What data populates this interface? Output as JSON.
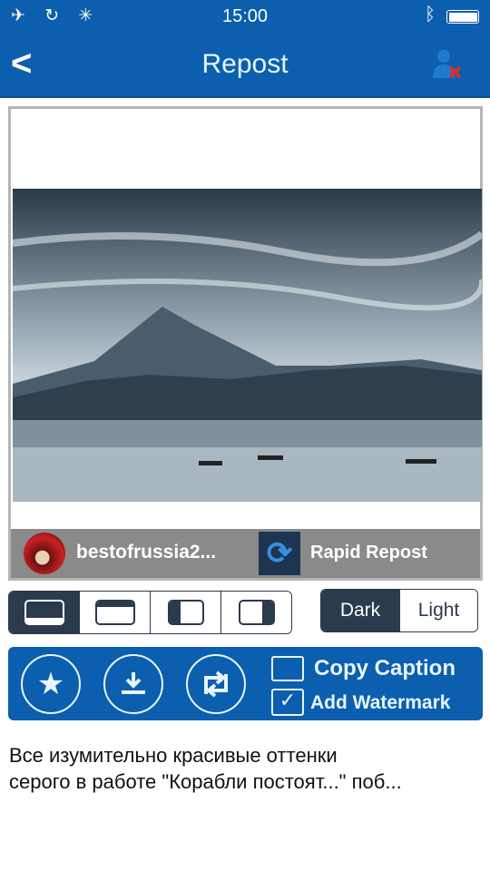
{
  "status_bar": {
    "time": "15:00",
    "left_icons": [
      "airplane-icon",
      "link-icon",
      "activity-spinner-icon"
    ],
    "right_icons": [
      "bluetooth-icon",
      "battery-icon"
    ],
    "battery_level": 1.0
  },
  "nav": {
    "title": "Repost",
    "back_icon": "chevron-left-icon",
    "right_icon": "remove-user-icon"
  },
  "preview": {
    "username": "bestofrussia2...",
    "brand": "Rapid Repost"
  },
  "position_options": {
    "icons": [
      "bottom-bar-icon",
      "top-bar-icon",
      "left-bar-icon",
      "right-bar-icon"
    ],
    "selected": 0
  },
  "theme": {
    "options": [
      "Dark",
      "Light"
    ],
    "selected": "Dark"
  },
  "actions": {
    "icons": [
      "star-icon",
      "download-icon",
      "repost-icon"
    ],
    "copy_caption": {
      "label": "Copy Caption",
      "checked": false
    },
    "add_watermark": {
      "label": "Add Watermark",
      "checked": true
    }
  },
  "caption": {
    "lines": [
      "Все изумительно красивые оттенки",
      "серого в работе \"Корабли постоят...\" поб..."
    ]
  },
  "colors": {
    "primary": "#0b5fae",
    "dark": "#2b3a4d",
    "bar": "#8a8a8a"
  }
}
